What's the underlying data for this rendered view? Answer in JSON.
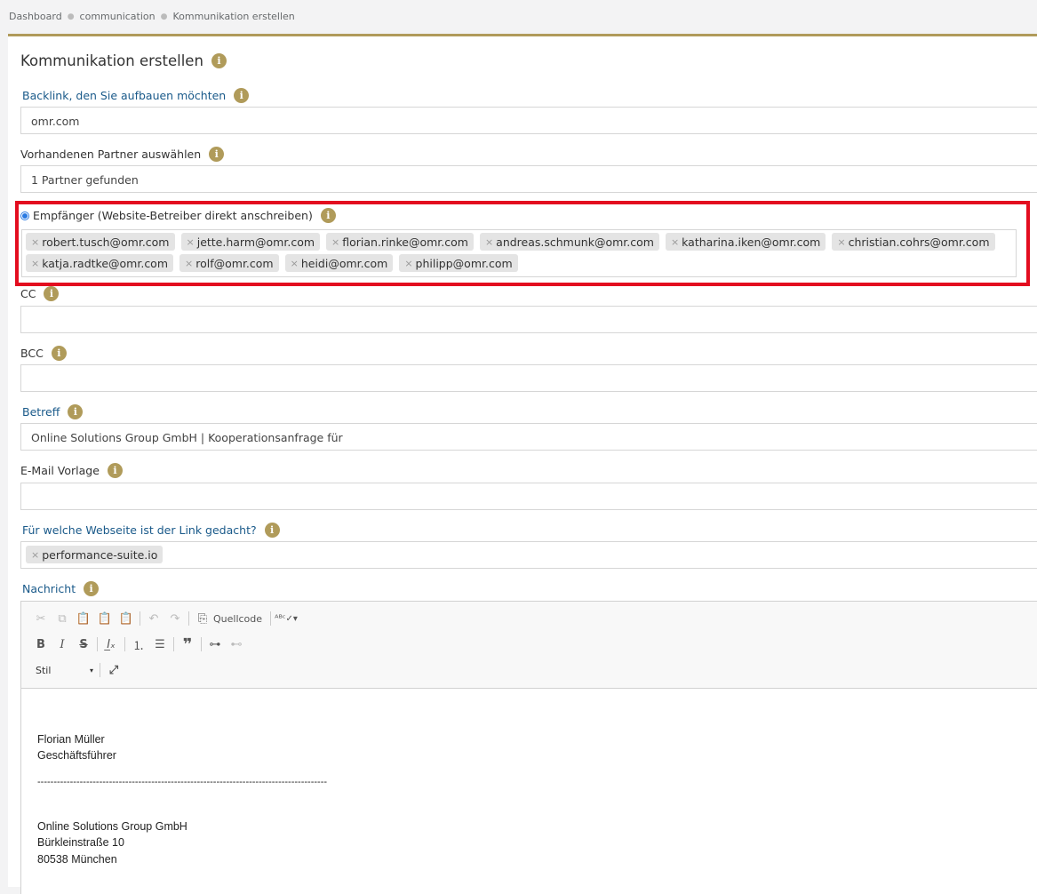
{
  "breadcrumb": [
    "Dashboard",
    "communication",
    "Kommunikation erstellen"
  ],
  "page_title": "Kommunikation erstellen",
  "backlink": {
    "label": "Backlink, den Sie aufbauen möchten",
    "value": "omr.com"
  },
  "partner": {
    "label": "Vorhandenen Partner auswählen",
    "value": "1 Partner gefunden"
  },
  "recipients": {
    "label": "Empfänger (Website-Betreiber direkt anschreiben)",
    "row1": [
      "robert.tusch@omr.com",
      "jette.harm@omr.com",
      "florian.rinke@omr.com",
      "andreas.schmunk@omr.com",
      "katharina.iken@omr.com",
      "christian.cohrs@omr.com"
    ],
    "row2": [
      "katja.radtke@omr.com",
      "rolf@omr.com",
      "heidi@omr.com",
      "philipp@omr.com"
    ]
  },
  "cc": {
    "label": "CC",
    "value": ""
  },
  "bcc": {
    "label": "BCC",
    "value": ""
  },
  "subject": {
    "label": "Betreff",
    "value": "Online Solutions Group GmbH | Kooperationsanfrage für"
  },
  "template": {
    "label": "E-Mail Vorlage",
    "value": ""
  },
  "website": {
    "label": "Für welche Webseite ist der Link gedacht?",
    "tag": "performance-suite.io"
  },
  "message": {
    "label": "Nachricht",
    "toolbar": {
      "source_label": "Quellcode",
      "style_label": "Stil"
    },
    "body_lines": [
      "Florian Müller",
      "Geschäftsführer",
      "-----------------------------------------------------------------------------------------",
      "Online Solutions Group GmbH",
      "Bürkleinstraße 10",
      "80538 München"
    ]
  },
  "colors": {
    "accent": "#b09b5a",
    "highlight_border": "#e30d1f",
    "link_label": "#1a5a8a"
  }
}
